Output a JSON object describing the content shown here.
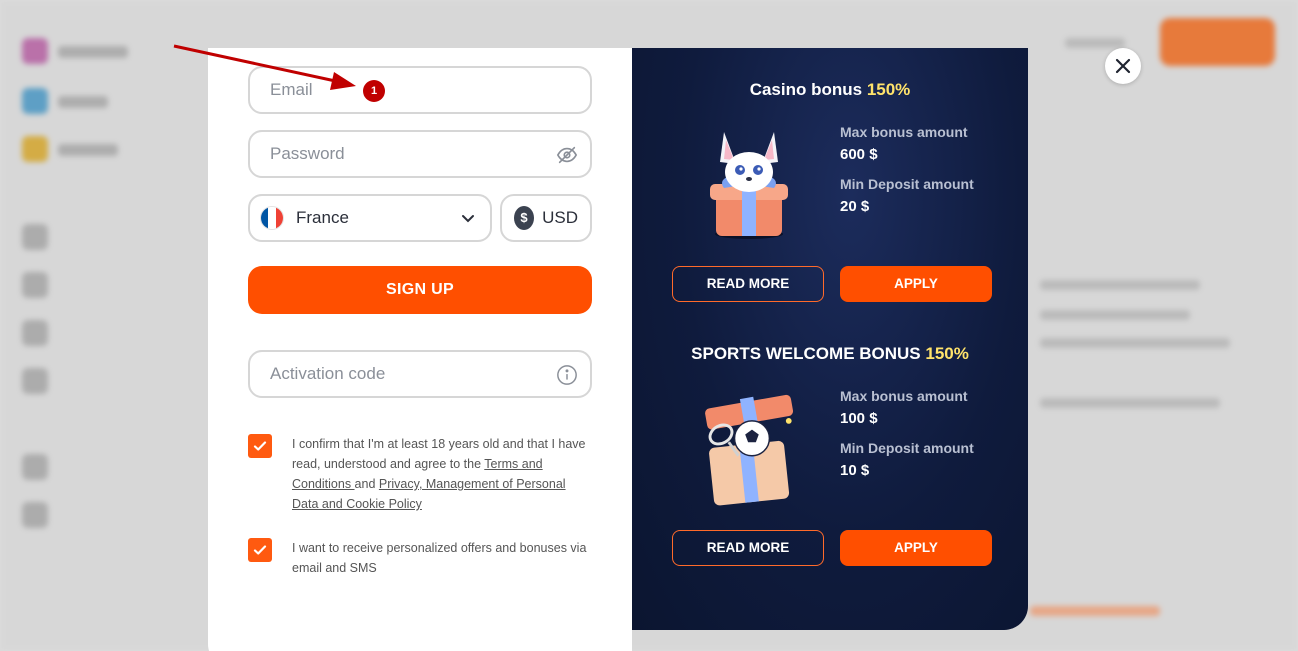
{
  "annotation": {
    "marker_number": "1"
  },
  "form": {
    "email_placeholder": "Email",
    "password_placeholder": "Password",
    "country": "France",
    "currency": "USD",
    "currency_symbol": "$",
    "signup_label": "SIGN UP",
    "activation_placeholder": "Activation code",
    "consent_age": {
      "text_start": "I confirm that I'm at least 18 years old and that I have read, understood and agree to the ",
      "link_terms": "Terms and Conditions ",
      "text_and": "and ",
      "link_privacy": "Privacy, Management of Personal Data and Cookie Policy",
      "checked": true
    },
    "consent_offers": {
      "text": "I want to receive personalized offers and bonuses via email and SMS",
      "checked": true
    }
  },
  "bonuses": [
    {
      "title": "Casino bonus ",
      "percent": "150%",
      "max_label": "Max bonus amount",
      "max_value": "600 $",
      "min_label": "Min Deposit amount",
      "min_value": "20 $",
      "read_more": "READ MORE",
      "apply": "APPLY"
    },
    {
      "title": "SPORTS WELCOME BONUS ",
      "percent": "150%",
      "max_label": "Max bonus amount",
      "max_value": "100 $",
      "min_label": "Min Deposit amount",
      "min_value": "10 $",
      "read_more": "READ MORE",
      "apply": "APPLY"
    }
  ],
  "colors": {
    "accent": "#ff4f00",
    "panel_dark": "#0f1b3d",
    "highlight": "#ffe36b"
  }
}
